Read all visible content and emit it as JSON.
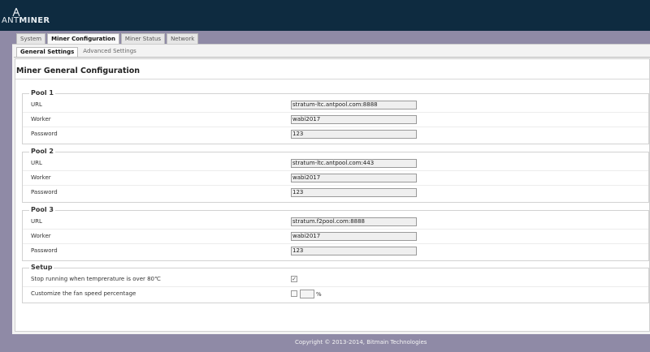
{
  "header": {
    "brand_prefix": "ANT",
    "brand_suffix": "MINER"
  },
  "tabs": [
    {
      "label": "System",
      "active": false
    },
    {
      "label": "Miner Configuration",
      "active": true
    },
    {
      "label": "Miner Status",
      "active": false
    },
    {
      "label": "Network",
      "active": false
    }
  ],
  "subtabs": [
    {
      "label": "General Settings",
      "active": true
    },
    {
      "label": "Advanced Settings",
      "active": false
    }
  ],
  "page": {
    "title": "Miner General Configuration"
  },
  "pools": [
    {
      "legend": "Pool 1",
      "url_label": "URL",
      "url": "stratum-ltc.antpool.com:8888",
      "worker_label": "Worker",
      "worker": "wabi2017",
      "password_label": "Password",
      "password": "123"
    },
    {
      "legend": "Pool 2",
      "url_label": "URL",
      "url": "stratum-ltc.antpool.com:443",
      "worker_label": "Worker",
      "worker": "wabi2017",
      "password_label": "Password",
      "password": "123"
    },
    {
      "legend": "Pool 3",
      "url_label": "URL",
      "url": "stratum.f2pool.com:8888",
      "worker_label": "Worker",
      "worker": "wabi2017",
      "password_label": "Password",
      "password": "123"
    }
  ],
  "setup": {
    "legend": "Setup",
    "stop_label": "Stop running when temprerature is over 80℃",
    "stop_checked": true,
    "stop_mark": "✓",
    "fan_label": "Customize the fan speed percentage",
    "fan_checked": false,
    "fan_unit": "%"
  },
  "footer": {
    "copyright": "Copyright © 2013-2014, Bitmain Technologies"
  },
  "colors": {
    "header_bg": "#0e2b40",
    "page_bg": "#8f8aa6"
  }
}
